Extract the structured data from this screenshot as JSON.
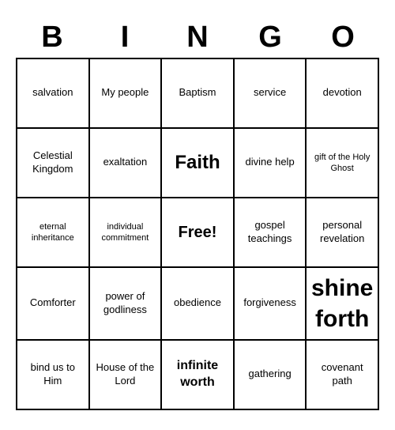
{
  "header": {
    "letters": [
      "B",
      "I",
      "N",
      "G",
      "O"
    ]
  },
  "grid": [
    [
      {
        "text": "salvation",
        "style": "normal"
      },
      {
        "text": "My people",
        "style": "normal"
      },
      {
        "text": "Baptism",
        "style": "normal"
      },
      {
        "text": "service",
        "style": "normal"
      },
      {
        "text": "devotion",
        "style": "normal"
      }
    ],
    [
      {
        "text": "Celestial Kingdom",
        "style": "normal"
      },
      {
        "text": "exaltation",
        "style": "normal"
      },
      {
        "text": "Faith",
        "style": "large"
      },
      {
        "text": "divine help",
        "style": "normal"
      },
      {
        "text": "gift of the Holy Ghost",
        "style": "small"
      }
    ],
    [
      {
        "text": "eternal inheritance",
        "style": "small"
      },
      {
        "text": "individual commitment",
        "style": "small"
      },
      {
        "text": "Free!",
        "style": "free"
      },
      {
        "text": "gospel teachings",
        "style": "normal"
      },
      {
        "text": "personal revelation",
        "style": "normal"
      }
    ],
    [
      {
        "text": "Comforter",
        "style": "normal"
      },
      {
        "text": "power of godliness",
        "style": "normal"
      },
      {
        "text": "obedience",
        "style": "normal"
      },
      {
        "text": "forgiveness",
        "style": "normal"
      },
      {
        "text": "shine forth",
        "style": "xlarge"
      }
    ],
    [
      {
        "text": "bind us to Him",
        "style": "normal"
      },
      {
        "text": "House of the Lord",
        "style": "normal"
      },
      {
        "text": "infinite worth",
        "style": "medium"
      },
      {
        "text": "gathering",
        "style": "normal"
      },
      {
        "text": "covenant path",
        "style": "normal"
      }
    ]
  ]
}
